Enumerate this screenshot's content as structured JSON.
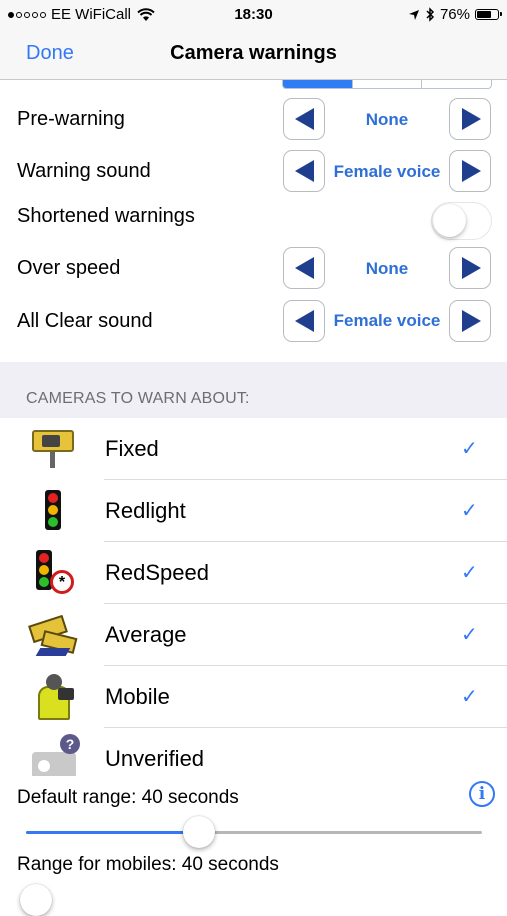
{
  "status_bar": {
    "carrier": "EE WiFiCall",
    "time": "18:30",
    "battery": "76%",
    "battery_level": 0.76,
    "signal_bars_filled": 1,
    "signal_bars_total": 5
  },
  "nav": {
    "done_label": "Done",
    "title": "Camera warnings"
  },
  "settings": [
    {
      "label": "Pre-warning",
      "value": "None"
    },
    {
      "label": "Warning sound",
      "value": "Female voice"
    },
    {
      "label": "Over speed",
      "value": "None"
    },
    {
      "label": "All Clear sound",
      "value": "Female voice"
    }
  ],
  "shortened_warnings": {
    "label": "Shortened warnings",
    "enabled": false
  },
  "cameras_header": "CAMERAS TO WARN ABOUT:",
  "cameras": [
    {
      "label": "Fixed",
      "checked": "✓",
      "icon": "fixed-camera-icon"
    },
    {
      "label": "Redlight",
      "checked": "✓",
      "icon": "traffic-light-icon"
    },
    {
      "label": "RedSpeed",
      "checked": "✓",
      "icon": "redspeed-camera-icon"
    },
    {
      "label": "Average",
      "checked": "✓",
      "icon": "average-speed-camera-icon"
    },
    {
      "label": "Mobile",
      "checked": "✓",
      "icon": "mobile-camera-icon"
    },
    {
      "label": "Unverified",
      "checked": "",
      "icon": "unverified-camera-icon"
    }
  ],
  "default_range": {
    "label": "Default range: 40 seconds",
    "fraction": 0.38
  },
  "mobile_range": {
    "label": "Range for mobiles: 40 seconds"
  },
  "info_glyph": "i",
  "colors": {
    "accent": "#3478f6",
    "arrow": "#1f3f8e",
    "value_text": "#2f6fd6"
  }
}
